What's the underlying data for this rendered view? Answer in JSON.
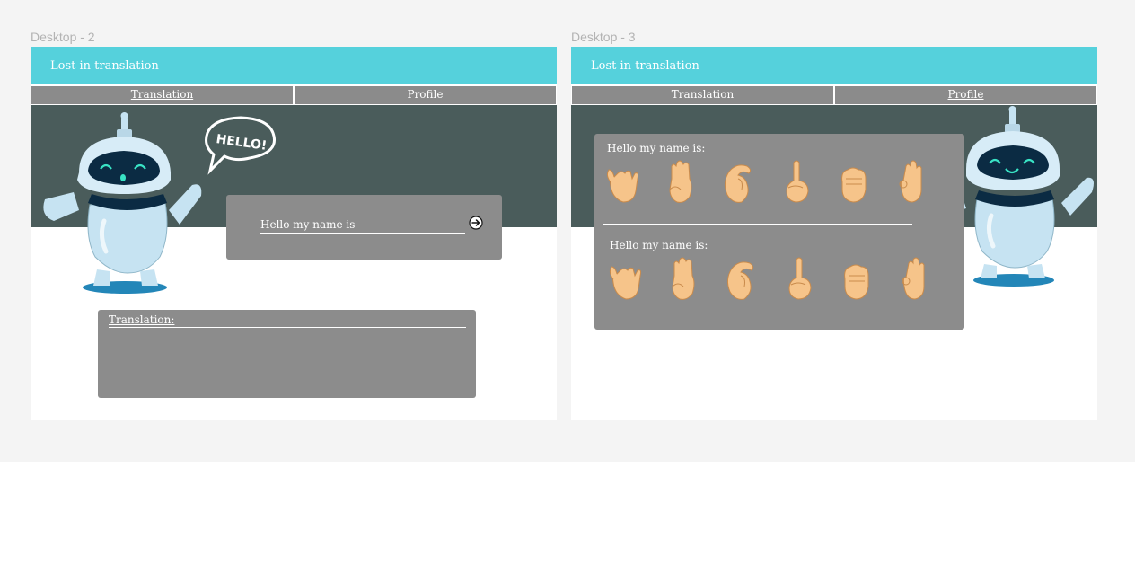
{
  "canvas": {
    "frames": [
      {
        "label": "Desktop - 2",
        "app_title": "Lost in translation",
        "tabs": [
          {
            "label": "Translation",
            "active": true
          },
          {
            "label": "Profile",
            "active": false
          }
        ],
        "speech_bubble": "HELLO!",
        "input": {
          "value": "",
          "placeholder": "Hello my name is"
        },
        "submit_icon": "arrow-right-circle-icon",
        "translation_label": "Translation:"
      },
      {
        "label": "Desktop - 3",
        "app_title": "Lost in translation",
        "tabs": [
          {
            "label": "Translation",
            "active": false
          },
          {
            "label": "Profile",
            "active": true
          }
        ],
        "history": [
          {
            "text": "Hello my name is:",
            "signs": [
              "hand-sign-y-icon",
              "hand-sign-b-icon",
              "hand-sign-c-icon",
              "hand-sign-d-icon",
              "hand-sign-e-icon",
              "hand-sign-f-icon"
            ]
          },
          {
            "text": "Hello my name is:",
            "signs": [
              "hand-sign-y-icon",
              "hand-sign-b-icon",
              "hand-sign-c-icon",
              "hand-sign-d-icon",
              "hand-sign-e-icon",
              "hand-sign-f-icon"
            ]
          }
        ]
      }
    ]
  },
  "colors": {
    "app_bar": "#55d1dc",
    "nav_tab": "#8b8b8b",
    "hero": "#4a5c5b",
    "panel": "#8c8c8c",
    "robot_body": "#c6e3f2",
    "robot_visor": "#0b2b43",
    "robot_shadow": "#2386b8",
    "hand_skin": "#f6c48a"
  }
}
